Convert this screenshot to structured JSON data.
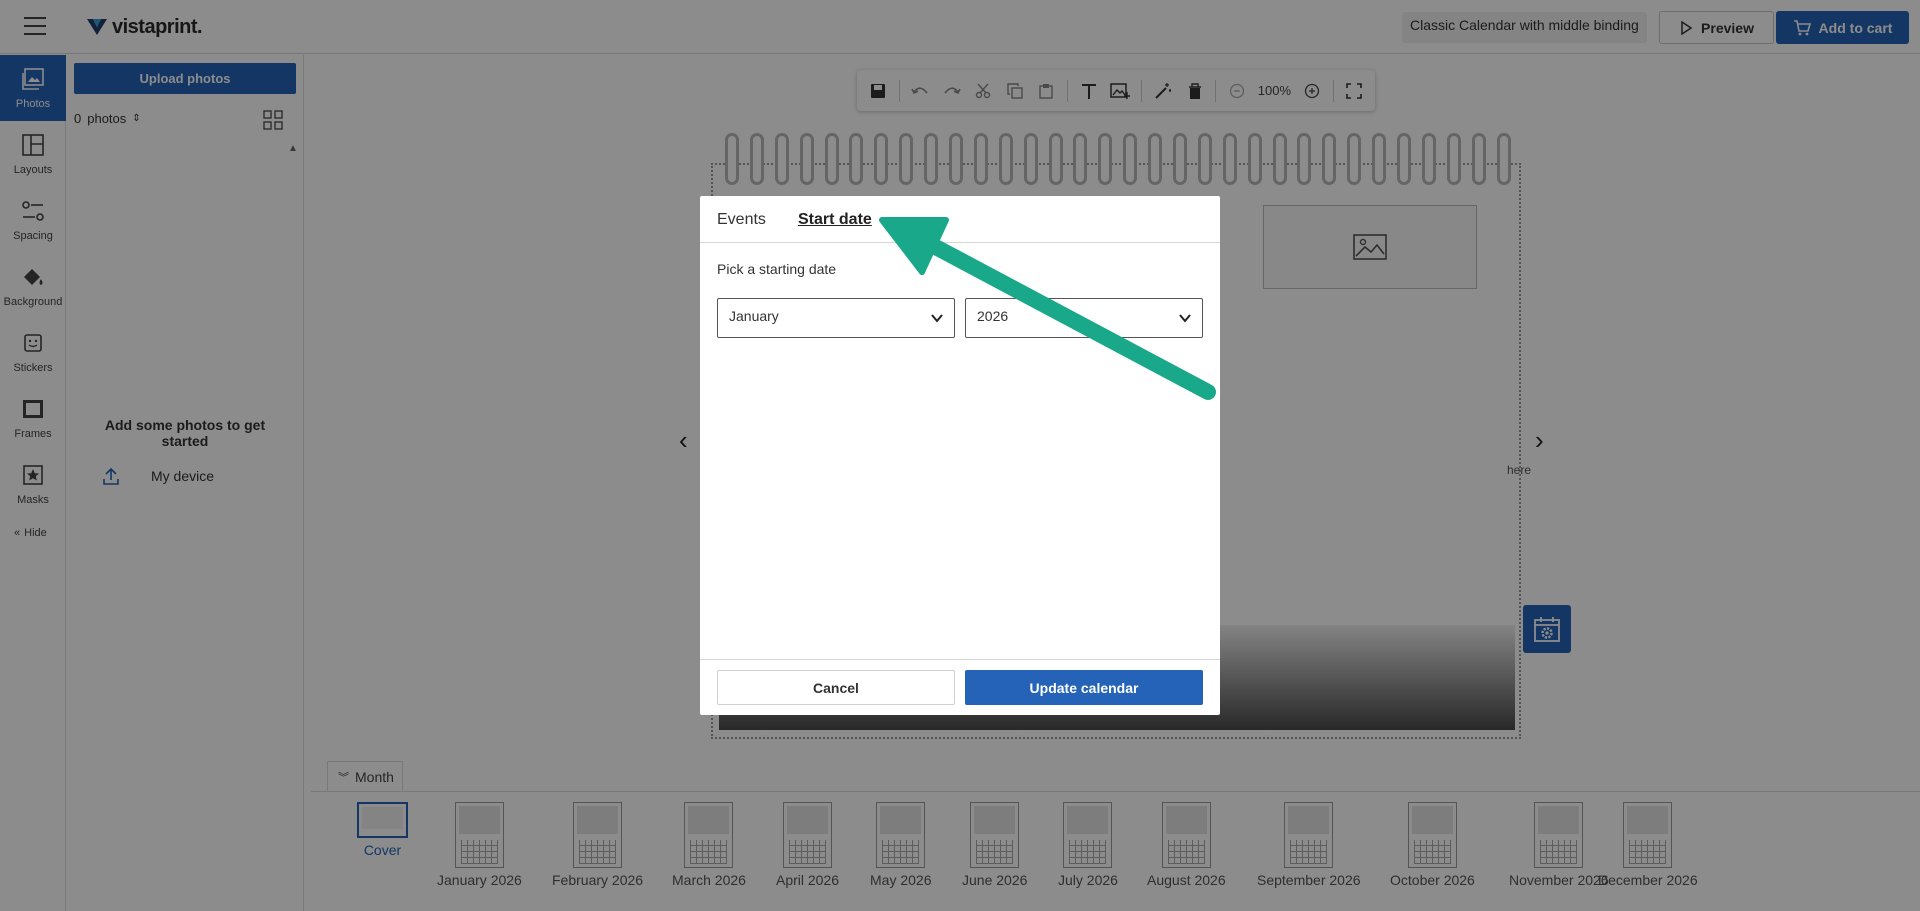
{
  "header": {
    "logo_text": "vistaprint.",
    "product_name": "Classic Calendar with middle binding",
    "preview_label": "Preview",
    "cart_label": "Add to cart"
  },
  "rail": {
    "items": [
      {
        "label": "Photos",
        "icon": "photos-icon"
      },
      {
        "label": "Layouts",
        "icon": "layouts-icon"
      },
      {
        "label": "Spacing",
        "icon": "spacing-icon"
      },
      {
        "label": "Background",
        "icon": "paint-bucket-icon"
      },
      {
        "label": "Stickers",
        "icon": "sticker-icon"
      },
      {
        "label": "Frames",
        "icon": "frame-icon"
      },
      {
        "label": "Masks",
        "icon": "mask-icon"
      }
    ],
    "hide_label": "Hide"
  },
  "panel": {
    "upload_label": "Upload photos",
    "photo_count": "0",
    "photo_count_unit": "photos",
    "empty_title": "Add some photos to get started",
    "device_label": "My device"
  },
  "toolbar": {
    "zoom": "100%"
  },
  "canvas": {
    "hint_text": "here"
  },
  "strip": {
    "tab_label": "Month",
    "pages": [
      "Cover",
      "January 2026",
      "February 2026",
      "March 2026",
      "April 2026",
      "May 2026",
      "June 2026",
      "July 2026",
      "August 2026",
      "September 2026",
      "October 2026",
      "November 2026",
      "December 2026"
    ]
  },
  "modal": {
    "tab_events": "Events",
    "tab_start_date": "Start date",
    "pick_label": "Pick a starting date",
    "month_value": "January",
    "year_value": "2026",
    "cancel_label": "Cancel",
    "update_label": "Update calendar"
  },
  "colors": {
    "accent": "#2563b8",
    "annotation_arrow": "#1aa88a"
  }
}
